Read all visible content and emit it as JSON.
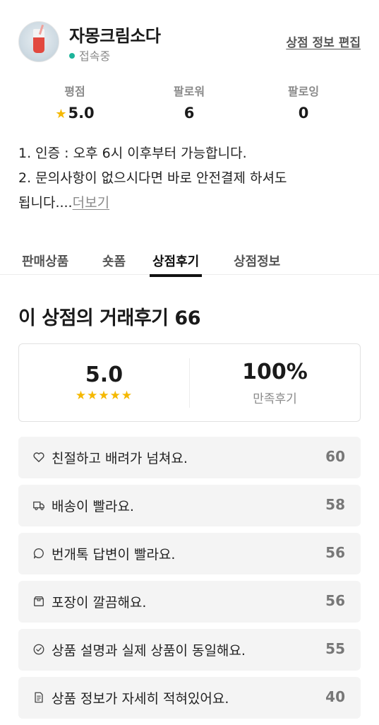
{
  "profile": {
    "shop_name": "자몽크림소다",
    "status": "접속중",
    "edit_label": "상점 정보 편집"
  },
  "stats": {
    "rating_label": "평점",
    "rating_value": "5.0",
    "followers_label": "팔로워",
    "followers_value": "6",
    "following_label": "팔로잉",
    "following_value": "0"
  },
  "intro": {
    "line1": "1. 인증 : 오후 6시 이후부터 가능합니다.",
    "line2": "2. 문의사항이 없으시다면 바로 안전결제 하셔도",
    "line3": "됩니다....",
    "more_label": "더보기"
  },
  "tabs": [
    {
      "label": "판매상품",
      "active": false
    },
    {
      "label": "숏폼",
      "active": false
    },
    {
      "label": "상점후기",
      "active": true
    },
    {
      "label": "상점정보",
      "active": false
    }
  ],
  "reviews": {
    "title": "이 상점의 거래후기 66",
    "score": "5.0",
    "stars": 5,
    "satisfaction": "100%",
    "satisfaction_label": "만족후기",
    "items": [
      {
        "icon": "heart-icon",
        "label": "친절하고 배려가 넘쳐요.",
        "count": "60"
      },
      {
        "icon": "truck-icon",
        "label": "배송이 빨라요.",
        "count": "58"
      },
      {
        "icon": "chat-bubble-icon",
        "label": "번개톡 답변이 빨라요.",
        "count": "56"
      },
      {
        "icon": "box-icon",
        "label": "포장이 깔끔해요.",
        "count": "56"
      },
      {
        "icon": "check-circle-icon",
        "label": "상품 설명과 실제 상품이 동일해요.",
        "count": "55"
      },
      {
        "icon": "document-icon",
        "label": "상품 정보가 자세히 적혀있어요.",
        "count": "40"
      }
    ]
  },
  "colors": {
    "star": "#f5b800",
    "online": "#1db49a",
    "item_bg": "#f4f4f4"
  }
}
